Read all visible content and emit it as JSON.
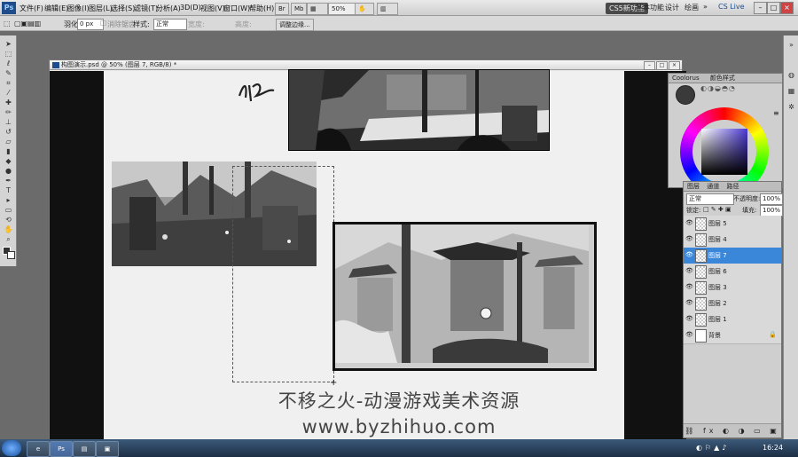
{
  "app": {
    "logo": "Ps",
    "menu": [
      "文件(F)",
      "编辑(E)",
      "图像(I)",
      "图层(L)",
      "选择(S)",
      "滤镜(T)",
      "分析(A)",
      "3D(D)",
      "视图(V)",
      "窗口(W)",
      "帮助(H)"
    ],
    "zoom": "50%",
    "workspaces": {
      "active": "CS5新功能",
      "items": [
        "基本功能",
        "设计",
        "绘画"
      ],
      "more": "»",
      "cs_live": "CS Live"
    }
  },
  "options_bar": {
    "feather_label": "羽化:",
    "feather_value": "0 px",
    "antialias_label": "消除锯齿",
    "style_label": "样式:",
    "style_value": "正常",
    "width_label": "宽度:",
    "height_label": "高度:",
    "refine_button": "调整边缘..."
  },
  "document": {
    "title": "构图演示.psd @ 50% (图层 7, RGB/8) *"
  },
  "color_panel": {
    "tabs": [
      "Coolorus",
      "颜色样式"
    ],
    "foreground_color": "#3a3a3a"
  },
  "layers_panel": {
    "tabs": [
      "图层",
      "通道",
      "路径"
    ],
    "blend_mode": "正常",
    "opacity_label": "不透明度:",
    "opacity_value": "100%",
    "lock_label": "锁定:",
    "fill_label": "填充:",
    "fill_value": "100%",
    "layers": [
      {
        "name": "图层 5",
        "active": false
      },
      {
        "name": "图层 4",
        "active": false
      },
      {
        "name": "图层 7",
        "active": true
      },
      {
        "name": "图层 6",
        "active": false
      },
      {
        "name": "图层 3",
        "active": false
      },
      {
        "name": "图层 2",
        "active": false
      },
      {
        "name": "图层 1",
        "active": false
      },
      {
        "name": "背景",
        "active": false
      }
    ]
  },
  "watermark": {
    "line1": "不移之火-动漫游戏美术资源",
    "line2": "www.byzhihuo.com"
  },
  "taskbar": {
    "clock": "16:24"
  },
  "colors": {
    "accent_layer": "#3a86d8",
    "menubar": "#d9d9d9",
    "pasteboard": "#111111"
  }
}
